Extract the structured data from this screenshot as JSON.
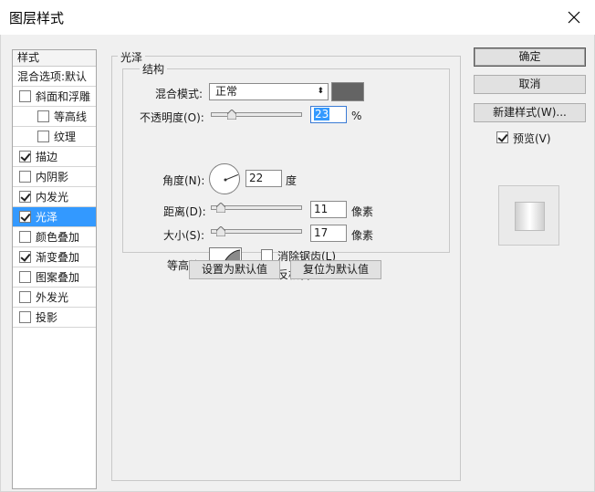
{
  "window": {
    "title": "图层样式"
  },
  "sidebar": {
    "header": "样式",
    "blend_options": "混合选项:默认",
    "items": [
      {
        "label": "斜面和浮雕",
        "checked": false,
        "sub": false
      },
      {
        "label": "等高线",
        "checked": false,
        "sub": true
      },
      {
        "label": "纹理",
        "checked": false,
        "sub": true
      },
      {
        "label": "描边",
        "checked": true,
        "sub": false
      },
      {
        "label": "内阴影",
        "checked": false,
        "sub": false
      },
      {
        "label": "内发光",
        "checked": true,
        "sub": false
      },
      {
        "label": "光泽",
        "checked": true,
        "sub": false,
        "selected": true
      },
      {
        "label": "颜色叠加",
        "checked": false,
        "sub": false
      },
      {
        "label": "渐变叠加",
        "checked": true,
        "sub": false
      },
      {
        "label": "图案叠加",
        "checked": false,
        "sub": false
      },
      {
        "label": "外发光",
        "checked": false,
        "sub": false
      },
      {
        "label": "投影",
        "checked": false,
        "sub": false
      }
    ]
  },
  "panel": {
    "group_title": "光泽",
    "structure_title": "结构",
    "blend_mode": {
      "label": "混合模式:",
      "value": "正常"
    },
    "color_swatch": "#646464",
    "opacity": {
      "label": "不透明度(O):",
      "value": "23",
      "unit": "%",
      "fraction": 0.23
    },
    "angle": {
      "label": "角度(N):",
      "value": "22",
      "unit": "度",
      "degrees": 22
    },
    "distance": {
      "label": "距离(D):",
      "value": "11",
      "unit": "像素"
    },
    "size": {
      "label": "大小(S):",
      "value": "17",
      "unit": "像素"
    },
    "contour": {
      "label": "等高线:"
    },
    "anti_alias": {
      "label": "消除锯齿(L)",
      "checked": false
    },
    "invert": {
      "label": "反相(I)",
      "checked": true
    },
    "set_default": "设置为默认值",
    "reset_default": "复位为默认值"
  },
  "actions": {
    "ok": "确定",
    "cancel": "取消",
    "new_style": "新建样式(W)...",
    "preview": {
      "label": "预览(V)",
      "checked": true
    }
  },
  "icons": {
    "close": "close-icon",
    "dropdown": "chevron-down-icon"
  }
}
